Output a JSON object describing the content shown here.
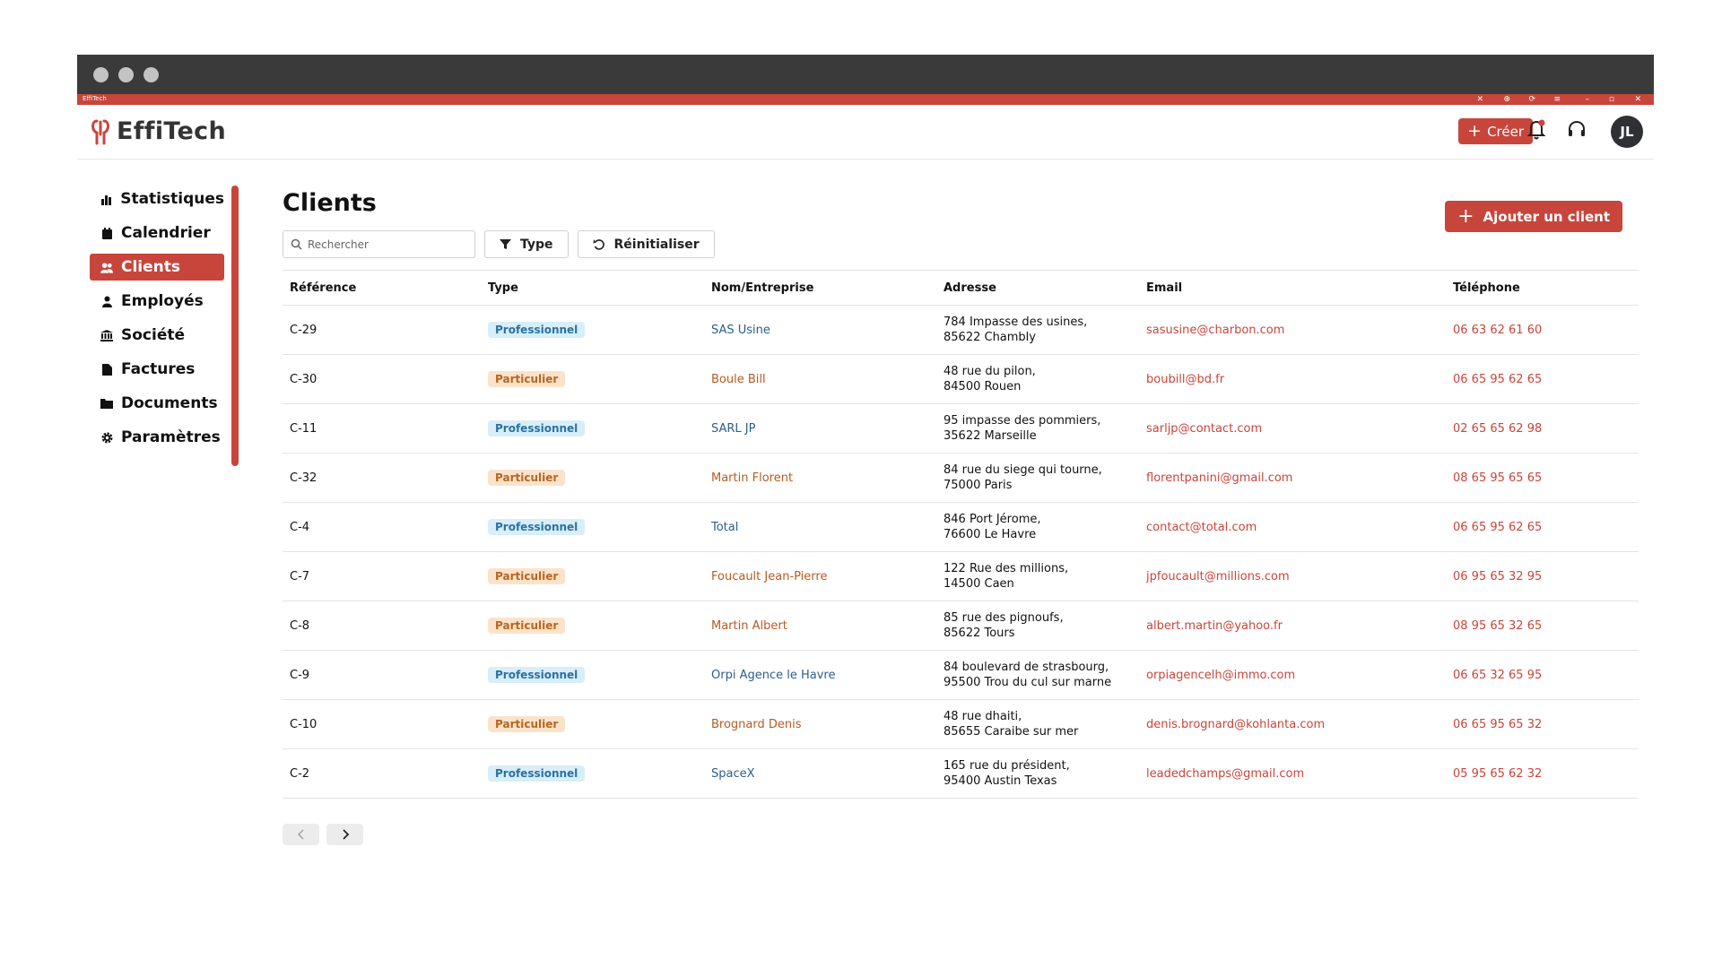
{
  "window": {
    "title": "EffiTech"
  },
  "app": {
    "brand": "EffiTech",
    "create_label": "Créer",
    "avatar_initials": "JL"
  },
  "sidebar": {
    "items": [
      {
        "label": "Statistiques",
        "icon": "bar-chart-icon"
      },
      {
        "label": "Calendrier",
        "icon": "calendar-icon"
      },
      {
        "label": "Clients",
        "icon": "users-icon",
        "active": true
      },
      {
        "label": "Employés",
        "icon": "user-icon"
      },
      {
        "label": "Société",
        "icon": "bank-icon"
      },
      {
        "label": "Factures",
        "icon": "file-icon"
      },
      {
        "label": "Documents",
        "icon": "folder-icon"
      },
      {
        "label": "Paramètres",
        "icon": "gear-icon"
      }
    ]
  },
  "main": {
    "title": "Clients",
    "add_client_label": "Ajouter un client",
    "search_placeholder": "Rechercher",
    "type_filter_label": "Type",
    "reset_label": "Réinitialiser"
  },
  "table": {
    "headers": [
      "Référence",
      "Type",
      "Nom/Entreprise",
      "Adresse",
      "Email",
      "Téléphone"
    ],
    "rows": [
      {
        "ref": "C-29",
        "type": "Professionnel",
        "kind": "pro",
        "name": "SAS Usine",
        "addr1": "784 Impasse des usines,",
        "addr2": "85622 Chambly",
        "email": "sasusine@charbon.com",
        "phone": "06 63 62 61 60"
      },
      {
        "ref": "C-30",
        "type": "Particulier",
        "kind": "part",
        "name": "Boule Bill",
        "addr1": "48 rue du pilon,",
        "addr2": "84500 Rouen",
        "email": "boubill@bd.fr",
        "phone": "06 65 95 62 65"
      },
      {
        "ref": "C-11",
        "type": "Professionnel",
        "kind": "pro",
        "name": "SARL JP",
        "addr1": "95 impasse des pommiers,",
        "addr2": "35622 Marseille",
        "email": "sarljp@contact.com",
        "phone": "02 65 65 62 98"
      },
      {
        "ref": "C-32",
        "type": "Particulier",
        "kind": "part",
        "name": "Martin Florent",
        "addr1": "84 rue du siege qui tourne,",
        "addr2": "75000 Paris",
        "email": "florentpanini@gmail.com",
        "phone": "08 65 95 65 65"
      },
      {
        "ref": "C-4",
        "type": "Professionnel",
        "kind": "pro",
        "name": "Total",
        "addr1": "846 Port Jérome,",
        "addr2": "76600 Le Havre",
        "email": "contact@total.com",
        "phone": "06 65 95 62 65"
      },
      {
        "ref": "C-7",
        "type": "Particulier",
        "kind": "part",
        "name": "Foucault Jean-Pierre",
        "addr1": "122 Rue des millions,",
        "addr2": "14500 Caen",
        "email": "jpfoucault@millions.com",
        "phone": "06 95 65 32 95"
      },
      {
        "ref": "C-8",
        "type": "Particulier",
        "kind": "part",
        "name": "Martin Albert",
        "addr1": "85 rue des pignoufs,",
        "addr2": "85622 Tours",
        "email": "albert.martin@yahoo.fr",
        "phone": "08 95 65 32 65"
      },
      {
        "ref": "C-9",
        "type": "Professionnel",
        "kind": "pro",
        "name": "Orpi Agence le Havre",
        "addr1": "84 boulevard de strasbourg,",
        "addr2": "95500 Trou du cul sur marne",
        "email": "orpiagencelh@immo.com",
        "phone": "06 65 32 65 95"
      },
      {
        "ref": "C-10",
        "type": "Particulier",
        "kind": "part",
        "name": "Brognard Denis",
        "addr1": "48 rue dhaiti,",
        "addr2": "85655 Caraibe sur mer",
        "email": "denis.brognard@kohlanta.com",
        "phone": "06 65 95 65 32"
      },
      {
        "ref": "C-2",
        "type": "Professionnel",
        "kind": "pro",
        "name": "SpaceX",
        "addr1": "165 rue du président,",
        "addr2": "95400 Austin Texas",
        "email": "leadedchamps@gmail.com",
        "phone": "05 95 65 62 32"
      }
    ]
  },
  "colors": {
    "accent": "#c8453b",
    "titlebar": "#3a3a3b"
  }
}
